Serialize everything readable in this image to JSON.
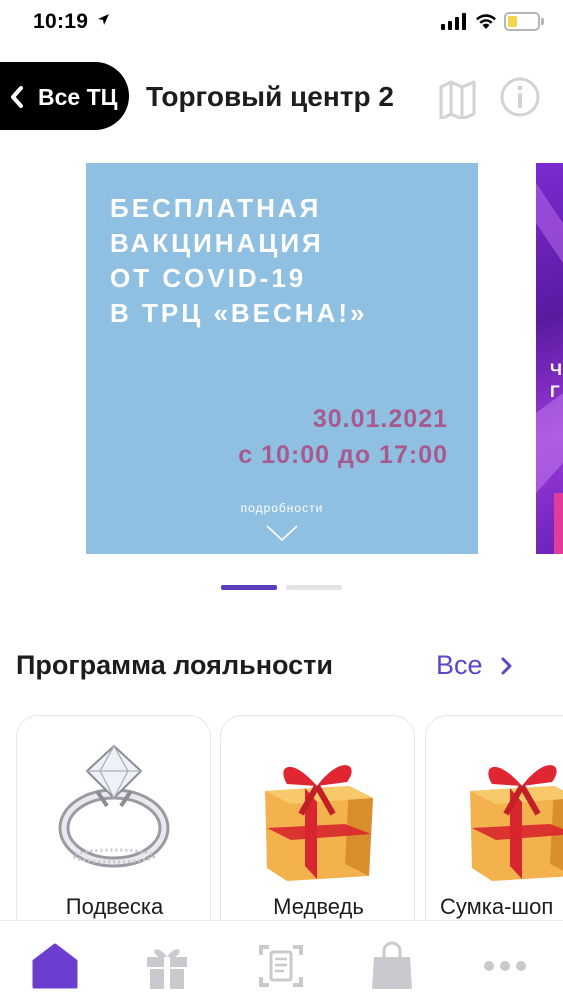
{
  "status_bar": {
    "time": "10:19",
    "battery_color": "#f4d447"
  },
  "header": {
    "back_label": "Все ТЦ",
    "title": "Торговый центр 2",
    "icons": [
      "map-icon",
      "info-icon"
    ]
  },
  "banner": {
    "heading_lines": [
      "БЕСПЛАТНАЯ",
      "ВАКЦИНАЦИЯ",
      "ОТ COVID-19",
      "В ТРЦ «ВЕСНА!»"
    ],
    "date": "30.01.2021",
    "time": "с 10:00 до 17:00",
    "more_label": "подробности",
    "background_color": "#8fc0e1",
    "date_color": "#a85a8e",
    "next_banner_text": "Ч\nГ"
  },
  "carousel": {
    "page_count": 2,
    "active_index": 0,
    "accent_color": "#5b3bbd"
  },
  "loyalty": {
    "title": "Программа лояльности",
    "all_label": "Все",
    "accent_color": "#5b48c9",
    "items": [
      {
        "label": "Подвеска",
        "image": "ring-icon"
      },
      {
        "label": "Медведь",
        "image": "gift-box-icon"
      },
      {
        "label": "Сумка-шоп",
        "image": "gift-box-icon"
      }
    ]
  },
  "tab_bar": {
    "active": "home",
    "tabs": [
      {
        "id": "home",
        "icon": "home-icon"
      },
      {
        "id": "gifts",
        "icon": "gift-icon"
      },
      {
        "id": "scan",
        "icon": "scan-receipt-icon"
      },
      {
        "id": "shop",
        "icon": "shopping-bag-icon"
      },
      {
        "id": "more",
        "icon": "more-icon"
      }
    ]
  }
}
